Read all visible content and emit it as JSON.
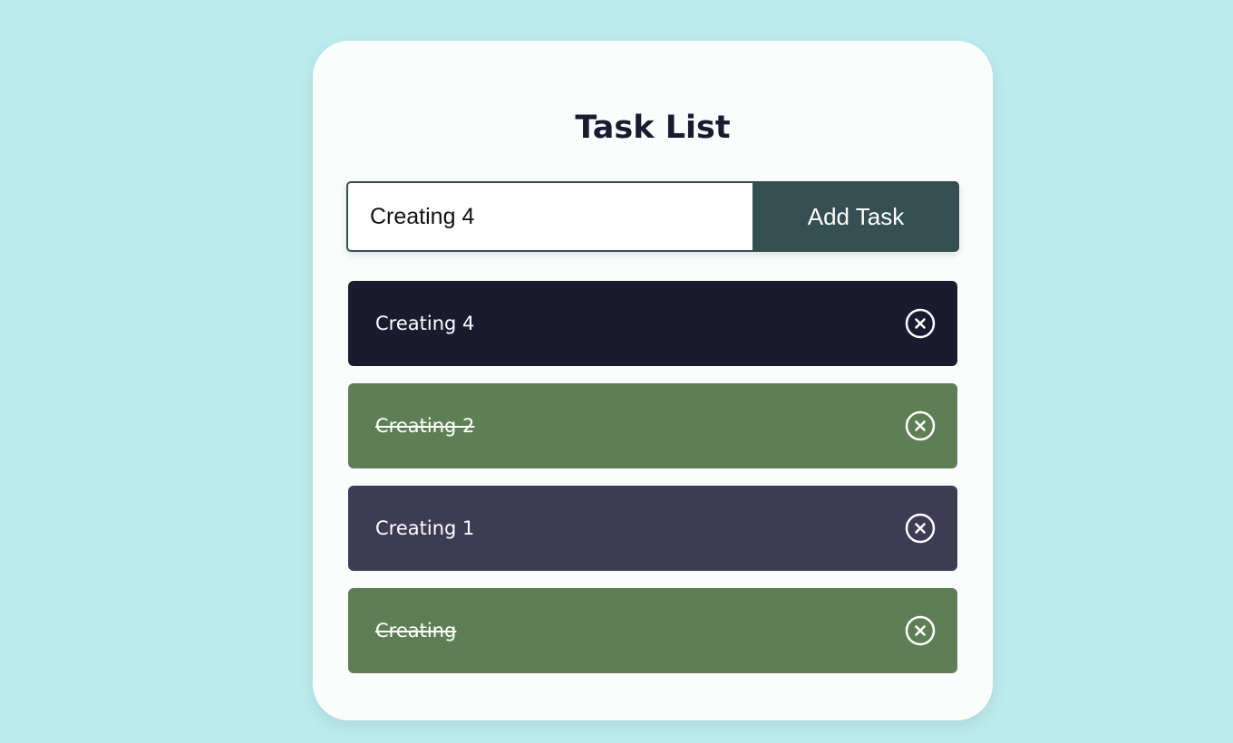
{
  "header": {
    "title": "Task List"
  },
  "input": {
    "value": "Creating 4",
    "button_label": "Add Task"
  },
  "tasks": [
    {
      "text": "Creating 4",
      "completed": false,
      "color": "#1b1b30",
      "icon": "close-circle-icon"
    },
    {
      "text": "Creating 2",
      "completed": true,
      "color": "#5e7f55",
      "icon": "close-circle-icon"
    },
    {
      "text": "Creating 1",
      "completed": false,
      "color": "#3e3c52",
      "icon": "close-circle-icon"
    },
    {
      "text": "Creating",
      "completed": true,
      "color": "#5e7f55",
      "icon": "close-circle-icon"
    }
  ],
  "colors": {
    "background": "#bbebec",
    "card": "#fbfdfc",
    "accent": "#354f52",
    "title": "#1b1b30"
  }
}
